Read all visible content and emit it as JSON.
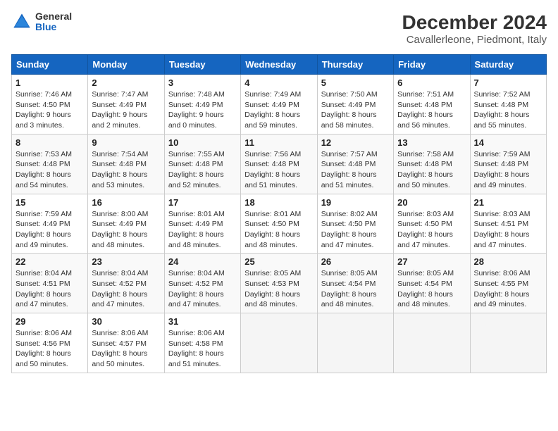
{
  "logo": {
    "line1": "General",
    "line2": "Blue"
  },
  "title": "December 2024",
  "subtitle": "Cavallerleone, Piedmont, Italy",
  "weekdays": [
    "Sunday",
    "Monday",
    "Tuesday",
    "Wednesday",
    "Thursday",
    "Friday",
    "Saturday"
  ],
  "weeks": [
    [
      {
        "day": 1,
        "sunrise": "7:46 AM",
        "sunset": "4:50 PM",
        "daylight": "9 hours and 3 minutes."
      },
      {
        "day": 2,
        "sunrise": "7:47 AM",
        "sunset": "4:49 PM",
        "daylight": "9 hours and 2 minutes."
      },
      {
        "day": 3,
        "sunrise": "7:48 AM",
        "sunset": "4:49 PM",
        "daylight": "9 hours and 0 minutes."
      },
      {
        "day": 4,
        "sunrise": "7:49 AM",
        "sunset": "4:49 PM",
        "daylight": "8 hours and 59 minutes."
      },
      {
        "day": 5,
        "sunrise": "7:50 AM",
        "sunset": "4:49 PM",
        "daylight": "8 hours and 58 minutes."
      },
      {
        "day": 6,
        "sunrise": "7:51 AM",
        "sunset": "4:48 PM",
        "daylight": "8 hours and 56 minutes."
      },
      {
        "day": 7,
        "sunrise": "7:52 AM",
        "sunset": "4:48 PM",
        "daylight": "8 hours and 55 minutes."
      }
    ],
    [
      {
        "day": 8,
        "sunrise": "7:53 AM",
        "sunset": "4:48 PM",
        "daylight": "8 hours and 54 minutes."
      },
      {
        "day": 9,
        "sunrise": "7:54 AM",
        "sunset": "4:48 PM",
        "daylight": "8 hours and 53 minutes."
      },
      {
        "day": 10,
        "sunrise": "7:55 AM",
        "sunset": "4:48 PM",
        "daylight": "8 hours and 52 minutes."
      },
      {
        "day": 11,
        "sunrise": "7:56 AM",
        "sunset": "4:48 PM",
        "daylight": "8 hours and 51 minutes."
      },
      {
        "day": 12,
        "sunrise": "7:57 AM",
        "sunset": "4:48 PM",
        "daylight": "8 hours and 51 minutes."
      },
      {
        "day": 13,
        "sunrise": "7:58 AM",
        "sunset": "4:48 PM",
        "daylight": "8 hours and 50 minutes."
      },
      {
        "day": 14,
        "sunrise": "7:59 AM",
        "sunset": "4:48 PM",
        "daylight": "8 hours and 49 minutes."
      }
    ],
    [
      {
        "day": 15,
        "sunrise": "7:59 AM",
        "sunset": "4:49 PM",
        "daylight": "8 hours and 49 minutes."
      },
      {
        "day": 16,
        "sunrise": "8:00 AM",
        "sunset": "4:49 PM",
        "daylight": "8 hours and 48 minutes."
      },
      {
        "day": 17,
        "sunrise": "8:01 AM",
        "sunset": "4:49 PM",
        "daylight": "8 hours and 48 minutes."
      },
      {
        "day": 18,
        "sunrise": "8:01 AM",
        "sunset": "4:50 PM",
        "daylight": "8 hours and 48 minutes."
      },
      {
        "day": 19,
        "sunrise": "8:02 AM",
        "sunset": "4:50 PM",
        "daylight": "8 hours and 47 minutes."
      },
      {
        "day": 20,
        "sunrise": "8:03 AM",
        "sunset": "4:50 PM",
        "daylight": "8 hours and 47 minutes."
      },
      {
        "day": 21,
        "sunrise": "8:03 AM",
        "sunset": "4:51 PM",
        "daylight": "8 hours and 47 minutes."
      }
    ],
    [
      {
        "day": 22,
        "sunrise": "8:04 AM",
        "sunset": "4:51 PM",
        "daylight": "8 hours and 47 minutes."
      },
      {
        "day": 23,
        "sunrise": "8:04 AM",
        "sunset": "4:52 PM",
        "daylight": "8 hours and 47 minutes."
      },
      {
        "day": 24,
        "sunrise": "8:04 AM",
        "sunset": "4:52 PM",
        "daylight": "8 hours and 47 minutes."
      },
      {
        "day": 25,
        "sunrise": "8:05 AM",
        "sunset": "4:53 PM",
        "daylight": "8 hours and 48 minutes."
      },
      {
        "day": 26,
        "sunrise": "8:05 AM",
        "sunset": "4:54 PM",
        "daylight": "8 hours and 48 minutes."
      },
      {
        "day": 27,
        "sunrise": "8:05 AM",
        "sunset": "4:54 PM",
        "daylight": "8 hours and 48 minutes."
      },
      {
        "day": 28,
        "sunrise": "8:06 AM",
        "sunset": "4:55 PM",
        "daylight": "8 hours and 49 minutes."
      }
    ],
    [
      {
        "day": 29,
        "sunrise": "8:06 AM",
        "sunset": "4:56 PM",
        "daylight": "8 hours and 50 minutes."
      },
      {
        "day": 30,
        "sunrise": "8:06 AM",
        "sunset": "4:57 PM",
        "daylight": "8 hours and 50 minutes."
      },
      {
        "day": 31,
        "sunrise": "8:06 AM",
        "sunset": "4:58 PM",
        "daylight": "8 hours and 51 minutes."
      },
      null,
      null,
      null,
      null
    ]
  ]
}
